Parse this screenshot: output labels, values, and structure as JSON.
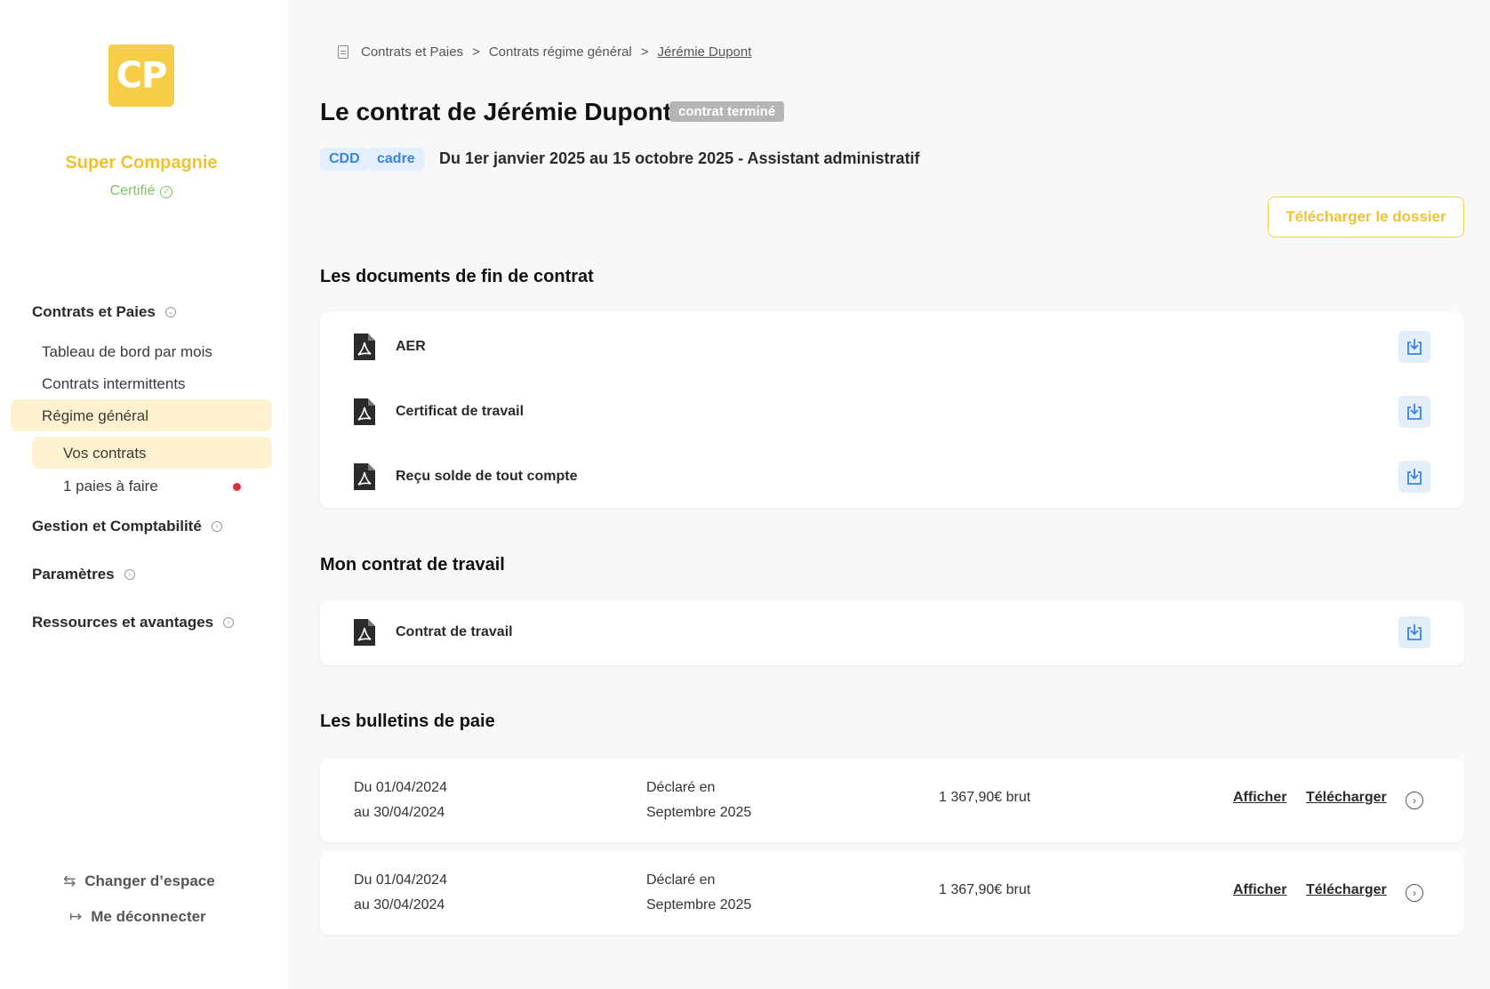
{
  "sidebar": {
    "logo_text": "CP",
    "company_name": "Super Compagnie",
    "certified_label": "Certifié",
    "sections": [
      {
        "label": "Contrats et Paies"
      },
      {
        "label": "Gestion et Comptabilité"
      },
      {
        "label": "Paramètres"
      },
      {
        "label": "Ressources et avantages"
      }
    ],
    "items": [
      {
        "label": "Tableau de bord par mois"
      },
      {
        "label": "Contrats intermittents"
      },
      {
        "label": "Régime général"
      },
      {
        "label": "Vos contrats"
      },
      {
        "label": "1 paies à faire"
      }
    ],
    "change_space": "Changer d’espace",
    "logout": "Me déconnecter"
  },
  "breadcrumb": {
    "items": [
      "Contrats et Paies",
      "Contrats régime général",
      "Jérémie Dupont"
    ],
    "separator": ">"
  },
  "header": {
    "title": "Le contrat de Jérémie Dupont",
    "status": "contrat terminé",
    "tags": [
      "CDD",
      "cadre"
    ],
    "subtitle": "Du 1er janvier 2025 au 15 octobre 2025 - Assistant administratif",
    "download_folder": "Télécharger le dossier"
  },
  "end_documents": {
    "title": "Les documents de fin de contrat",
    "items": [
      {
        "name": "AER"
      },
      {
        "name": "Certificat de travail"
      },
      {
        "name": "Reçu solde de tout compte"
      }
    ]
  },
  "contract": {
    "title": "Mon contrat de travail",
    "items": [
      {
        "name": "Contrat de travail"
      }
    ]
  },
  "payslips": {
    "title": "Les bulletins de paie",
    "items": [
      {
        "period_from": "Du 01/04/2024",
        "period_to": "au 30/04/2024",
        "declared_label": "Déclaré en",
        "declared_month": "Septembre 2025",
        "amount": "1 367,90€ brut",
        "view": "Afficher",
        "download": "Télécharger"
      },
      {
        "period_from": "Du 01/04/2024",
        "period_to": "au 30/04/2024",
        "declared_label": "Déclaré en",
        "declared_month": "Septembre 2025",
        "amount": "1 367,90€ brut",
        "view": "Afficher",
        "download": "Télécharger"
      }
    ]
  },
  "colors": {
    "brand_yellow": "#f6cd46",
    "certified_green": "#7ec35b",
    "tag_blue": "#3a83e6",
    "highlight": "#fdf1cf",
    "alert_red": "#d8323f"
  }
}
